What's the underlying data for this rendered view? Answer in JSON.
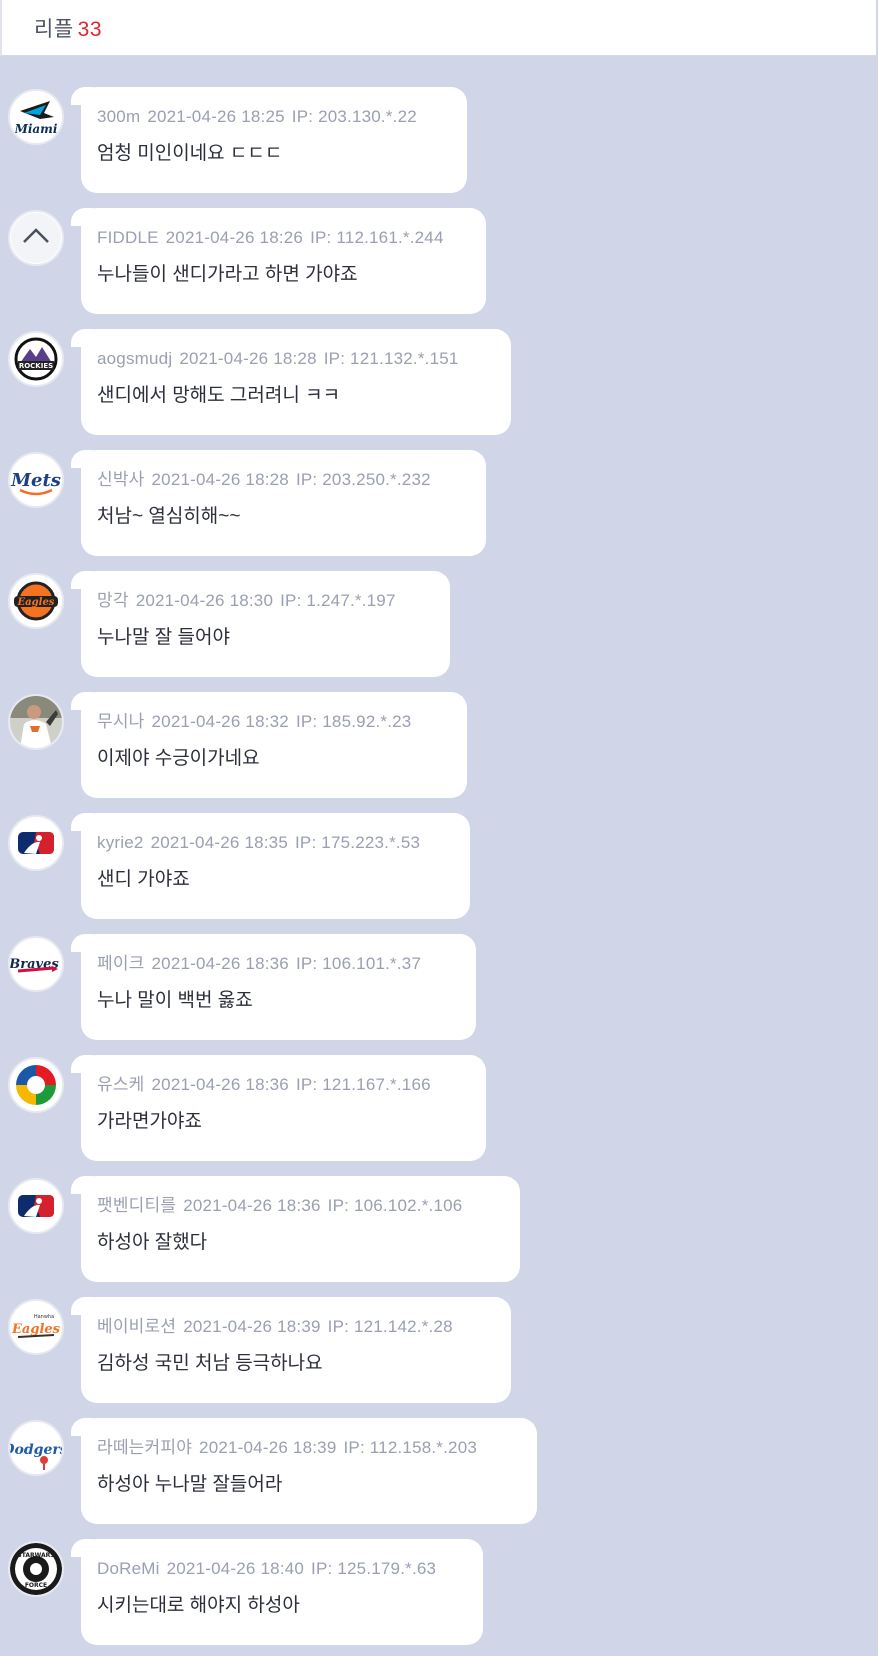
{
  "header": {
    "label": "리플",
    "count": "33"
  },
  "colors": {
    "background": "#d0d6e8",
    "bubble": "#ffffff",
    "count": "#e0252f",
    "meta": "#9aa0b2"
  },
  "comments": [
    {
      "nick": "300m",
      "date": "2021-04-26 18:25",
      "ip": "IP: 203.130.*.22",
      "text": "엄청 미인이네요 ㄷㄷㄷ",
      "avatar": "marlins-logo-icon"
    },
    {
      "nick": "FIDDLE",
      "date": "2021-04-26 18:26",
      "ip": "IP: 112.161.*.244",
      "text": "누나들이 샌디가라고 하면 가야죠",
      "avatar": "chevron-up-icon"
    },
    {
      "nick": "aogsmudj",
      "date": "2021-04-26 18:28",
      "ip": "IP: 121.132.*.151",
      "text": "샌디에서 망해도 그러려니 ㅋㅋ",
      "avatar": "rockies-logo-icon"
    },
    {
      "nick": "신박사",
      "date": "2021-04-26 18:28",
      "ip": "IP: 203.250.*.232",
      "text": "처남~ 열심히해~~",
      "avatar": "mets-logo-icon"
    },
    {
      "nick": "망각",
      "date": "2021-04-26 18:30",
      "ip": "IP: 1.247.*.197",
      "text": "누나말 잘 들어야",
      "avatar": "eagles-logo-icon"
    },
    {
      "nick": "무시나",
      "date": "2021-04-26 18:32",
      "ip": "IP: 185.92.*.23",
      "text": "이제야 수긍이가네요",
      "avatar": "pitcher-photo-icon"
    },
    {
      "nick": "kyrie2",
      "date": "2021-04-26 18:35",
      "ip": "IP: 175.223.*.53",
      "text": "샌디 가야죠",
      "avatar": "mlb-logo-icon"
    },
    {
      "nick": "페이크",
      "date": "2021-04-26 18:36",
      "ip": "IP: 106.101.*.37",
      "text": "누나 말이 백번 옳죠",
      "avatar": "braves-logo-icon"
    },
    {
      "nick": "유스케",
      "date": "2021-04-26 18:36",
      "ip": "IP: 121.167.*.166",
      "text": "가라면가야죠",
      "avatar": "wbc-logo-icon"
    },
    {
      "nick": "팻벤디티를",
      "date": "2021-04-26 18:36",
      "ip": "IP: 106.102.*.106",
      "text": "하성아 잘했다",
      "avatar": "mlb-logo-icon"
    },
    {
      "nick": "베이비로션",
      "date": "2021-04-26 18:39",
      "ip": "IP: 121.142.*.28",
      "text": "김하성 국민 처남 등극하나요",
      "avatar": "hanwha-eagles-logo-icon"
    },
    {
      "nick": "라떼는커피야",
      "date": "2021-04-26 18:39",
      "ip": "IP: 112.158.*.203",
      "text": "하성아 누나말 잘들어라",
      "avatar": "dodgers-logo-icon"
    },
    {
      "nick": "DoReMi",
      "date": "2021-04-26 18:40",
      "ip": "IP: 125.179.*.63",
      "text": "시키는대로 해야지 하성아",
      "avatar": "starwars-force-logo-icon"
    }
  ]
}
